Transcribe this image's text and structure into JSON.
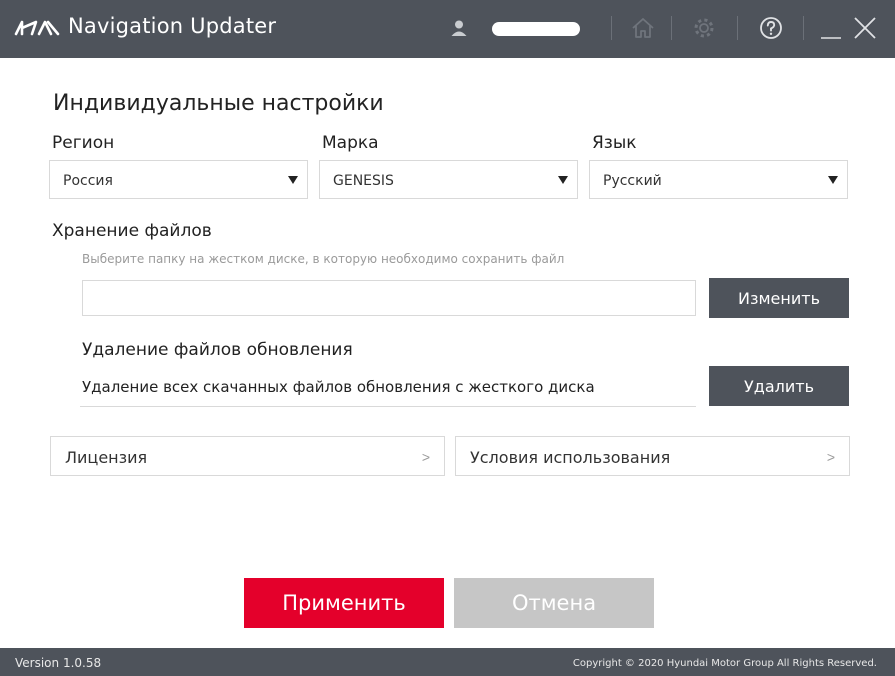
{
  "window": {
    "title": "Navigation Updater",
    "logo": "kia-logo",
    "icons": [
      "user-icon",
      "home-icon",
      "gear-icon",
      "help-icon",
      "minimize-icon",
      "close-icon"
    ]
  },
  "settings": {
    "title": "Индивидуальные настройки",
    "region": {
      "label": "Регион",
      "value": "Россия"
    },
    "brand": {
      "label": "Марка",
      "value": "GENESIS"
    },
    "language": {
      "label": "Язык",
      "value": "Русский"
    }
  },
  "storage": {
    "title": "Хранение файлов",
    "hint": "Выберите папку на жестком диске, в которую необходимо сохранить файл",
    "path_value": "",
    "change_label": "Изменить"
  },
  "deletion": {
    "title": "Удаление файлов обновления",
    "description": "Удаление всех скачанных файлов обновления с жесткого диска",
    "delete_label": "Удалить"
  },
  "links": {
    "license": "Лицензия",
    "terms": "Условия использования",
    "chevron": ">"
  },
  "actions": {
    "apply": "Применить",
    "cancel": "Отмена"
  },
  "footer": {
    "version": "Version 1.0.58",
    "copyright": "Copyright © 2020 Hyundai Motor Group All Rights Reserved."
  },
  "colors": {
    "titlebar": "#4e535b",
    "accent": "#e4002b",
    "disabled": "#c6c6c6"
  }
}
